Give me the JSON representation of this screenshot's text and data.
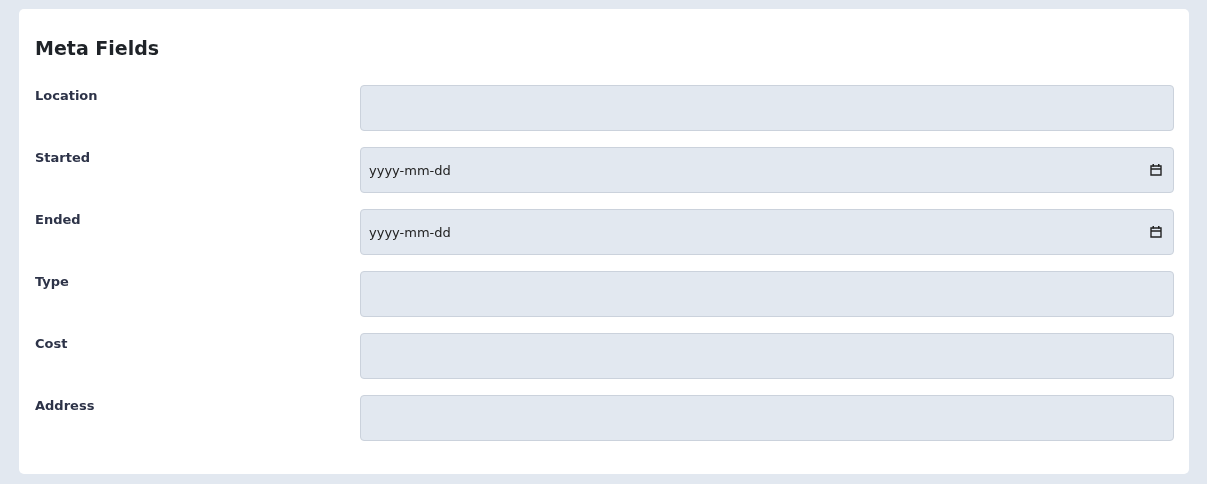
{
  "title": "Meta Fields",
  "fields": [
    {
      "label": "Location",
      "kind": "text"
    },
    {
      "label": "Started",
      "kind": "date",
      "placeholder": "yyyy-mm-dd"
    },
    {
      "label": "Ended",
      "kind": "date",
      "placeholder": "yyyy-mm-dd"
    },
    {
      "label": "Type",
      "kind": "text"
    },
    {
      "label": "Cost",
      "kind": "text"
    },
    {
      "label": "Address",
      "kind": "text"
    }
  ]
}
